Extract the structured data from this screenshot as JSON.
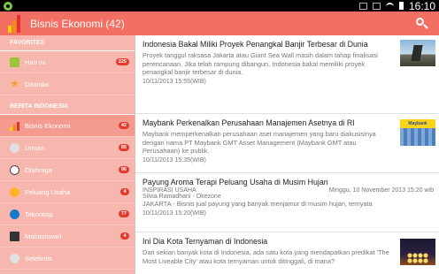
{
  "statusbar": {
    "time": "16:10"
  },
  "actionbar": {
    "title": "Bisnis Ekonomi (42)"
  },
  "sidebar": {
    "favorites_header": "FAVORITES",
    "favorites": [
      {
        "label": "Hari ini",
        "badge": "225",
        "icon": "rss-icon"
      },
      {
        "label": "Ditandai",
        "badge": "",
        "icon": "star-icon"
      }
    ],
    "berita_header": "BERITA INDONESIA",
    "berita": [
      {
        "label": "Bisnis Ekonomi",
        "badge": "42",
        "icon": "chart-icon"
      },
      {
        "label": "Umum",
        "badge": "85",
        "icon": "globe-icon"
      },
      {
        "label": "Olahraga",
        "badge": "96",
        "icon": "soccer-ball-icon"
      },
      {
        "label": "Peluang Usaha",
        "badge": "4",
        "icon": "coin-icon"
      },
      {
        "label": "Teknologi",
        "badge": "77",
        "icon": "technology-icon"
      },
      {
        "label": "Mahasiswa/i",
        "badge": "4",
        "icon": "graduation-cap-icon"
      },
      {
        "label": "Selebritis",
        "badge": "",
        "icon": "celebrity-icon"
      }
    ]
  },
  "articles": [
    {
      "title": "Indonesia Bakal Miliki Proyek Penangkal Banjir Terbesar di Dunia",
      "summary": "Proyek tanggul raksasa Jakarta atau Giant Sea Wall masih dalam tahap finalisasi perencanaan. Jika telah rampung dibangun, Indonesia bakal memiliki proyek penangkal banjir terbesar di dunia.",
      "time": "10/11/2013 15:55(WIB)"
    },
    {
      "title": "Maybank Perkenalkan Perusahaan Manajemen Asetnya di RI",
      "summary": "Maybank memperkenalkan perusahaan aset manajemen yang baru diakusisinya dengan nama PT Maybank GMT Asset Management (Maybank GMT atau Perusahaan) ke publik.",
      "time": "10/11/2013 15:35(WIB)",
      "thumb_text": "Maybank"
    },
    {
      "title": "Payung Aroma Terapi Peluang Usaha di Musim Hujan",
      "source": "INSPIRASI USAHA",
      "date": "Minggu, 10 November 2013 15:20 wib",
      "author": "Silvia Ramadhani - Okezone",
      "summary": "JAKARTA - Bisnis jual payung yang banyak menjamur di musim hujan, ternyata",
      "time": "10/11/2013 15:20(WIB)"
    },
    {
      "title": "Ini Dia Kota Ternyaman di Indonesia",
      "summary": "Dari sekian banyak kota di Indonesia, ada satu kota yang mendapatkan predikat 'The Most Liveable City' atau kota ternyaman untuk ditinggali, di mana?",
      "time": ""
    }
  ]
}
